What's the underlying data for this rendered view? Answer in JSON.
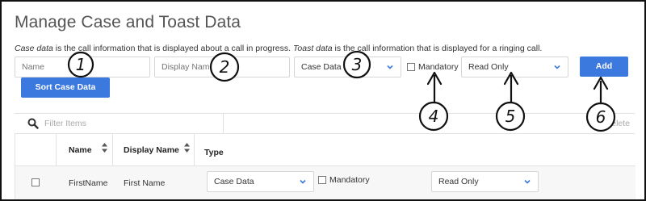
{
  "page": {
    "title": "Manage Case and Toast Data",
    "description": {
      "part1_em": "Case data",
      "part2": " is the call information that is displayed about a call in progress. ",
      "part3_em": "Toast data",
      "part4": " is the call information that is displayed for a ringing call."
    }
  },
  "form": {
    "name_placeholder": "Name",
    "display_name_placeholder": "Display Name",
    "type_value": "Case Data",
    "mandatory_label": "Mandatory",
    "access_value": "Read Only",
    "add_label": "Add",
    "sort_label": "Sort Case Data"
  },
  "filter": {
    "placeholder": "Filter Items",
    "delete_label": "Delete"
  },
  "table": {
    "headers": [
      "Name",
      "Display Name",
      "Type"
    ],
    "rows": [
      {
        "name": "FirstName",
        "display_name": "First Name",
        "type": "Case Data",
        "mandatory_label": "Mandatory",
        "access": "Read Only"
      }
    ]
  },
  "annotations": [
    "1",
    "2",
    "3",
    "4",
    "5",
    "6"
  ],
  "colors": {
    "primary_button": "#3b79de",
    "annotation_ink": "#111111",
    "border": "#d6d6d6"
  }
}
